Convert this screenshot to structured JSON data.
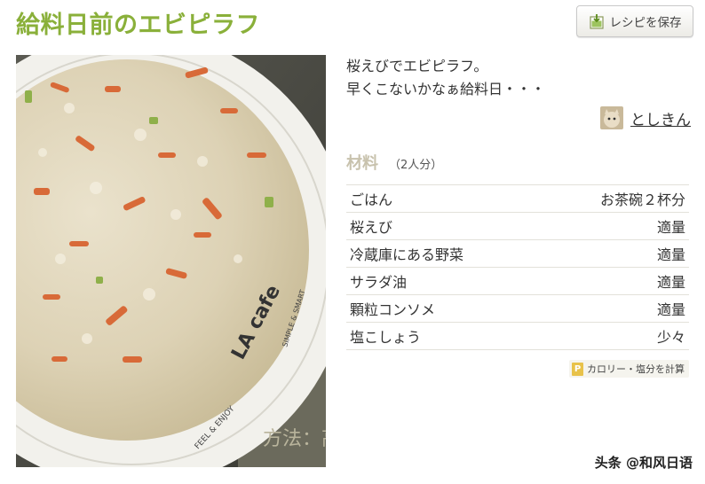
{
  "recipe": {
    "title": "給料日前のエビピラフ",
    "save_label": "レシピを保存",
    "description_lines": [
      "桜えびでエビピラフ。",
      "早くこないかなぁ給料日・・・"
    ],
    "author": "としきん",
    "photo_plate_text": "LA cafe",
    "photo_rim_text_1": "FEEL & ENJOY",
    "photo_rim_text_2": "SIMPLE & SMART",
    "photo_box_text": "方法：高"
  },
  "ingredients": {
    "heading": "材料",
    "servings": "（2人分）",
    "items": [
      {
        "name": "ごはん",
        "qty": "お茶碗２杯分"
      },
      {
        "name": "桜えび",
        "qty": "適量"
      },
      {
        "name": "冷蔵庫にある野菜",
        "qty": "適量"
      },
      {
        "name": "サラダ油",
        "qty": "適量"
      },
      {
        "name": "顆粒コンソメ",
        "qty": "適量"
      },
      {
        "name": "塩こしょう",
        "qty": "少々"
      }
    ]
  },
  "calc_label": "カロリー・塩分を計算",
  "watermark": "头条 @和风日语",
  "colors": {
    "title": "#8ab03a",
    "ingredients_heading": "#c8c2ad",
    "calc_icon": "#e8c24a"
  },
  "icons": {
    "save": "save-icon",
    "calc": "p-icon"
  }
}
